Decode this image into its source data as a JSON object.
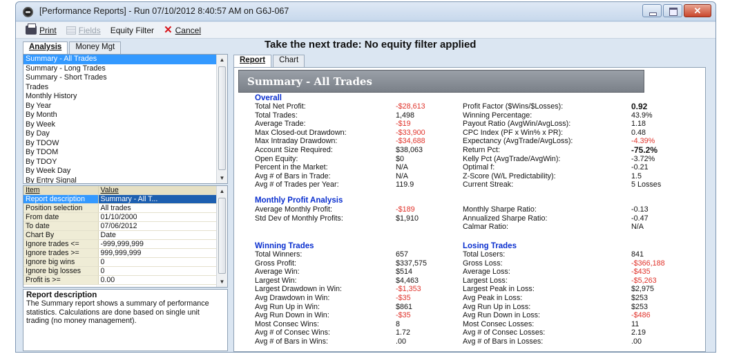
{
  "window": {
    "title": "[Performance Reports]  -  Run 07/10/2012 8:40:57 AM on G6J-067",
    "close_glyph": "✕"
  },
  "toolbar": {
    "print_label": "Print",
    "fields_label": "Fields",
    "equity_filter_label": "Equity Filter",
    "cancel_label": "Cancel"
  },
  "left_tabs": [
    "Analysis",
    "Money Mgt"
  ],
  "report_list": [
    "Summary - All Trades",
    "Summary - Long Trades",
    "Summary - Short Trades",
    "Trades",
    "Monthly History",
    "By Year",
    "By Month",
    "By Week",
    "By Day",
    "By TDOW",
    "By TDOM",
    "By TDOY",
    "By Week Day",
    "By Entry Signal"
  ],
  "properties": {
    "header": {
      "item": "Item",
      "value": "Value"
    },
    "rows": [
      {
        "item": "Report description",
        "value": "Summary - All T..."
      },
      {
        "item": "Position selection",
        "value": "All trades"
      },
      {
        "item": "From date",
        "value": "01/10/2000"
      },
      {
        "item": "To date",
        "value": "07/06/2012"
      },
      {
        "item": "Chart By",
        "value": "Date"
      },
      {
        "item": "Ignore trades <=",
        "value": "-999,999,999"
      },
      {
        "item": "Ignore trades >=",
        "value": "999,999,999"
      },
      {
        "item": "Ignore big wins",
        "value": "0"
      },
      {
        "item": "Ignore big losses",
        "value": "0"
      },
      {
        "item": "Profit is >=",
        "value": "0.00"
      }
    ]
  },
  "description": {
    "title": "Report description",
    "text": "The Summary report shows a summary of performance statistics.  Calculations are done based on single unit trading (no money management)."
  },
  "headline": "Take the next trade: No equity filter applied",
  "right_tabs": [
    "Report",
    "Chart"
  ],
  "report": {
    "banner": "Summary - All Trades",
    "overall": {
      "title": "Overall",
      "left": [
        {
          "label": "Total Net Profit:",
          "value": "-$28,613"
        },
        {
          "label": "Total Trades:",
          "value": "1,498"
        },
        {
          "label": "Average Trade:",
          "value": "-$19"
        },
        {
          "label": "Max Closed-out Drawdown:",
          "value": "-$33,900"
        },
        {
          "label": "Max Intraday Drawdown:",
          "value": "-$34,688"
        },
        {
          "label": "Account Size Required:",
          "value": "$38,063"
        },
        {
          "label": "Open Equity:",
          "value": "$0"
        },
        {
          "label": "Percent in the Market:",
          "value": "N/A"
        },
        {
          "label": "Avg # of Bars in Trade:",
          "value": "N/A"
        },
        {
          "label": "Avg # of Trades per Year:",
          "value": "119.9"
        }
      ],
      "right": [
        {
          "label": "Profit Factor ($Wins/$Losses):",
          "value": "0.92"
        },
        {
          "label": "Winning Percentage:",
          "value": "43.9%"
        },
        {
          "label": "Payout Ratio (AvgWin/AvgLoss):",
          "value": "1.18"
        },
        {
          "label": "CPC Index (PF x Win% x PR):",
          "value": "0.48"
        },
        {
          "label": "Expectancy (AvgTrade/AvgLoss):",
          "value": "-4.39%"
        },
        {
          "label": "Return Pct:",
          "value": "-75.2%"
        },
        {
          "label": "Kelly Pct (AvgTrade/AvgWin):",
          "value": "-3.72%"
        },
        {
          "label": "Optimal f:",
          "value": "-0.21"
        },
        {
          "label": "Z-Score (W/L Predictability):",
          "value": "1.5"
        },
        {
          "label": "Current Streak:",
          "value": "5 Losses"
        }
      ]
    },
    "monthly": {
      "title": "Monthly Profit Analysis",
      "left": [
        {
          "label": "Average Monthly Profit:",
          "value": "-$189"
        },
        {
          "label": "Std Dev of Monthly Profits:",
          "value": "$1,910"
        }
      ],
      "right": [
        {
          "label": "Monthly Sharpe Ratio:",
          "value": "-0.13"
        },
        {
          "label": "Annualized Sharpe Ratio:",
          "value": "-0.47"
        },
        {
          "label": "Calmar Ratio:",
          "value": "N/A"
        }
      ]
    },
    "winning": {
      "title": "Winning Trades",
      "rows": [
        {
          "label": "Total Winners:",
          "value": "657"
        },
        {
          "label": "Gross Profit:",
          "value": "$337,575"
        },
        {
          "label": "Average Win:",
          "value": "$514"
        },
        {
          "label": "Largest Win:",
          "value": "$4,463"
        },
        {
          "label": "Largest Drawdown in Win:",
          "value": "-$1,353"
        },
        {
          "label": "Avg Drawdown in Win:",
          "value": "-$35"
        },
        {
          "label": "Avg Run Up in Win:",
          "value": "$861"
        },
        {
          "label": "Avg Run Down in Win:",
          "value": "-$35"
        },
        {
          "label": "Most Consec Wins:",
          "value": "8"
        },
        {
          "label": "Avg # of Consec Wins:",
          "value": "1.72"
        },
        {
          "label": "Avg # of Bars in Wins:",
          "value": ".00"
        }
      ]
    },
    "losing": {
      "title": "Losing Trades",
      "rows": [
        {
          "label": "Total Losers:",
          "value": "841"
        },
        {
          "label": "Gross Loss:",
          "value": "-$366,188"
        },
        {
          "label": "Average Loss:",
          "value": "-$435"
        },
        {
          "label": "Largest Loss:",
          "value": "-$5,263"
        },
        {
          "label": "Largest Peak in Loss:",
          "value": "$2,975"
        },
        {
          "label": "Avg Peak in Loss:",
          "value": "$253"
        },
        {
          "label": "Avg Run Up in Loss:",
          "value": "$253"
        },
        {
          "label": "Avg Run Down in Loss:",
          "value": "-$486"
        },
        {
          "label": "Most Consec Losses:",
          "value": "11"
        },
        {
          "label": "Avg # of Consec Losses:",
          "value": "2.19"
        },
        {
          "label": "Avg # of Bars in Losses:",
          "value": ".00"
        }
      ]
    }
  },
  "colors": {
    "negative": "#e0322a",
    "section_title": "#0a2fcf",
    "selection": "#3399ff"
  }
}
